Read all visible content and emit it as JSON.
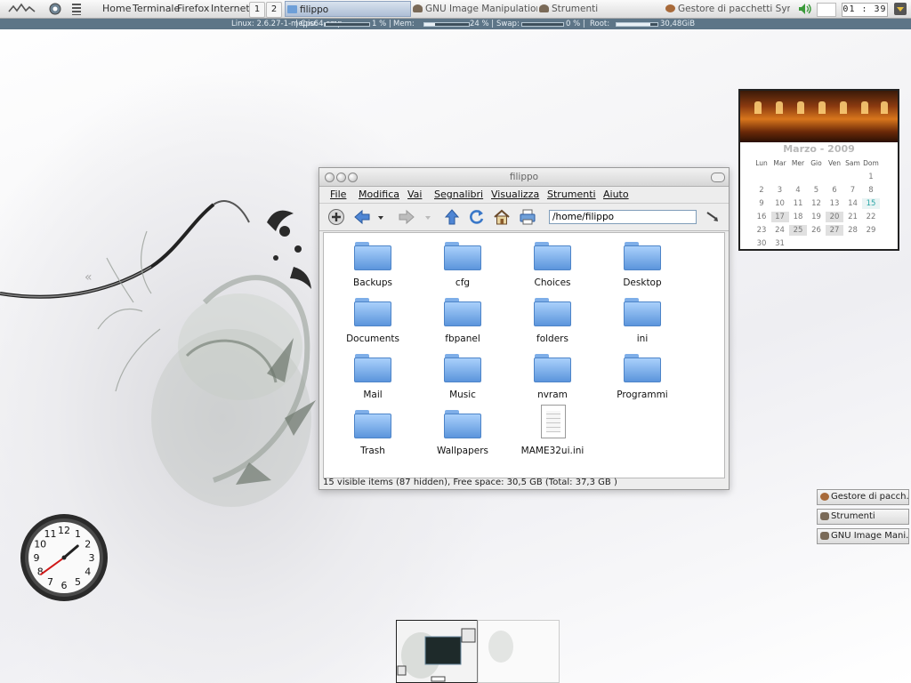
{
  "panel": {
    "menu_items": [
      "Home",
      "Terminale",
      "Firefox",
      "Internet"
    ],
    "desktops": [
      "1",
      "2"
    ],
    "tasks": [
      {
        "label": "filippo",
        "icon": "folder-icon",
        "active": true
      },
      {
        "label": "GNU Image Manipulation P...",
        "icon": "gimp-icon",
        "active": false
      },
      {
        "label": "Strumenti",
        "icon": "gimp-icon",
        "active": false
      },
      {
        "label": "Gestore di pacchetti Syna...",
        "icon": "package-icon",
        "active": false
      }
    ],
    "clock": "01 : 39"
  },
  "sysbar": {
    "kernel": "Linux: 2.6.27-1-mepis64-smp",
    "cpu_label": "| Cpu:",
    "cpu_value": "1 % |",
    "cpu_fraction": 0.01,
    "mem_label": "Mem:",
    "mem_value": "24 % |",
    "mem_fraction": 0.24,
    "swap_label": "Swap:",
    "swap_value": "0 % |",
    "swap_fraction": 0.0,
    "root_label": "Root:",
    "root_value": "30,48GiB"
  },
  "file_manager": {
    "title": "filippo",
    "menu": [
      "File",
      "Modifica",
      "Vai",
      "Segnalibri",
      "Visualizza",
      "Strumenti",
      "Aiuto"
    ],
    "path": "/home/filippo",
    "items": [
      {
        "name": "Backups",
        "type": "folder"
      },
      {
        "name": "cfg",
        "type": "folder"
      },
      {
        "name": "Choices",
        "type": "folder"
      },
      {
        "name": "Desktop",
        "type": "folder"
      },
      {
        "name": "Documents",
        "type": "folder"
      },
      {
        "name": "fbpanel",
        "type": "folder"
      },
      {
        "name": "folders",
        "type": "folder"
      },
      {
        "name": "ini",
        "type": "folder"
      },
      {
        "name": "Mail",
        "type": "folder"
      },
      {
        "name": "Music",
        "type": "folder"
      },
      {
        "name": "nvram",
        "type": "folder"
      },
      {
        "name": "Programmi",
        "type": "folder"
      },
      {
        "name": "Trash",
        "type": "folder"
      },
      {
        "name": "Wallpapers",
        "type": "folder"
      },
      {
        "name": "MAME32ui.ini",
        "type": "file"
      }
    ],
    "status": "15 visible items (87 hidden), Free space: 30,5 GB (Total: 37,3 GB )"
  },
  "calendar": {
    "month": "Marzo - 2009",
    "weekdays": [
      "Lun",
      "Mar",
      "Mer",
      "Gio",
      "Ven",
      "Sam",
      "Dom"
    ],
    "weeks": [
      [
        "",
        "",
        "",
        "",
        "",
        "",
        "1"
      ],
      [
        "2",
        "3",
        "4",
        "5",
        "6",
        "7",
        "8"
      ],
      [
        "9",
        "10",
        "11",
        "12",
        "13",
        "14",
        "15"
      ],
      [
        "16",
        "17",
        "18",
        "19",
        "20",
        "21",
        "22"
      ],
      [
        "23",
        "24",
        "25",
        "26",
        "27",
        "28",
        "29"
      ],
      [
        "30",
        "31",
        "",
        "",
        "",
        "",
        ""
      ]
    ],
    "highlighted": [
      "17",
      "20",
      "25",
      "27"
    ],
    "today": "15"
  },
  "analog_clock": {
    "numbers": [
      "12",
      "1",
      "2",
      "3",
      "4",
      "5",
      "6",
      "7",
      "8",
      "9",
      "10",
      "11"
    ],
    "hour": 1,
    "minute": 39
  },
  "right_tasks": [
    "Gestore di pacch...",
    "Strumenti",
    "GNU Image Mani..."
  ]
}
